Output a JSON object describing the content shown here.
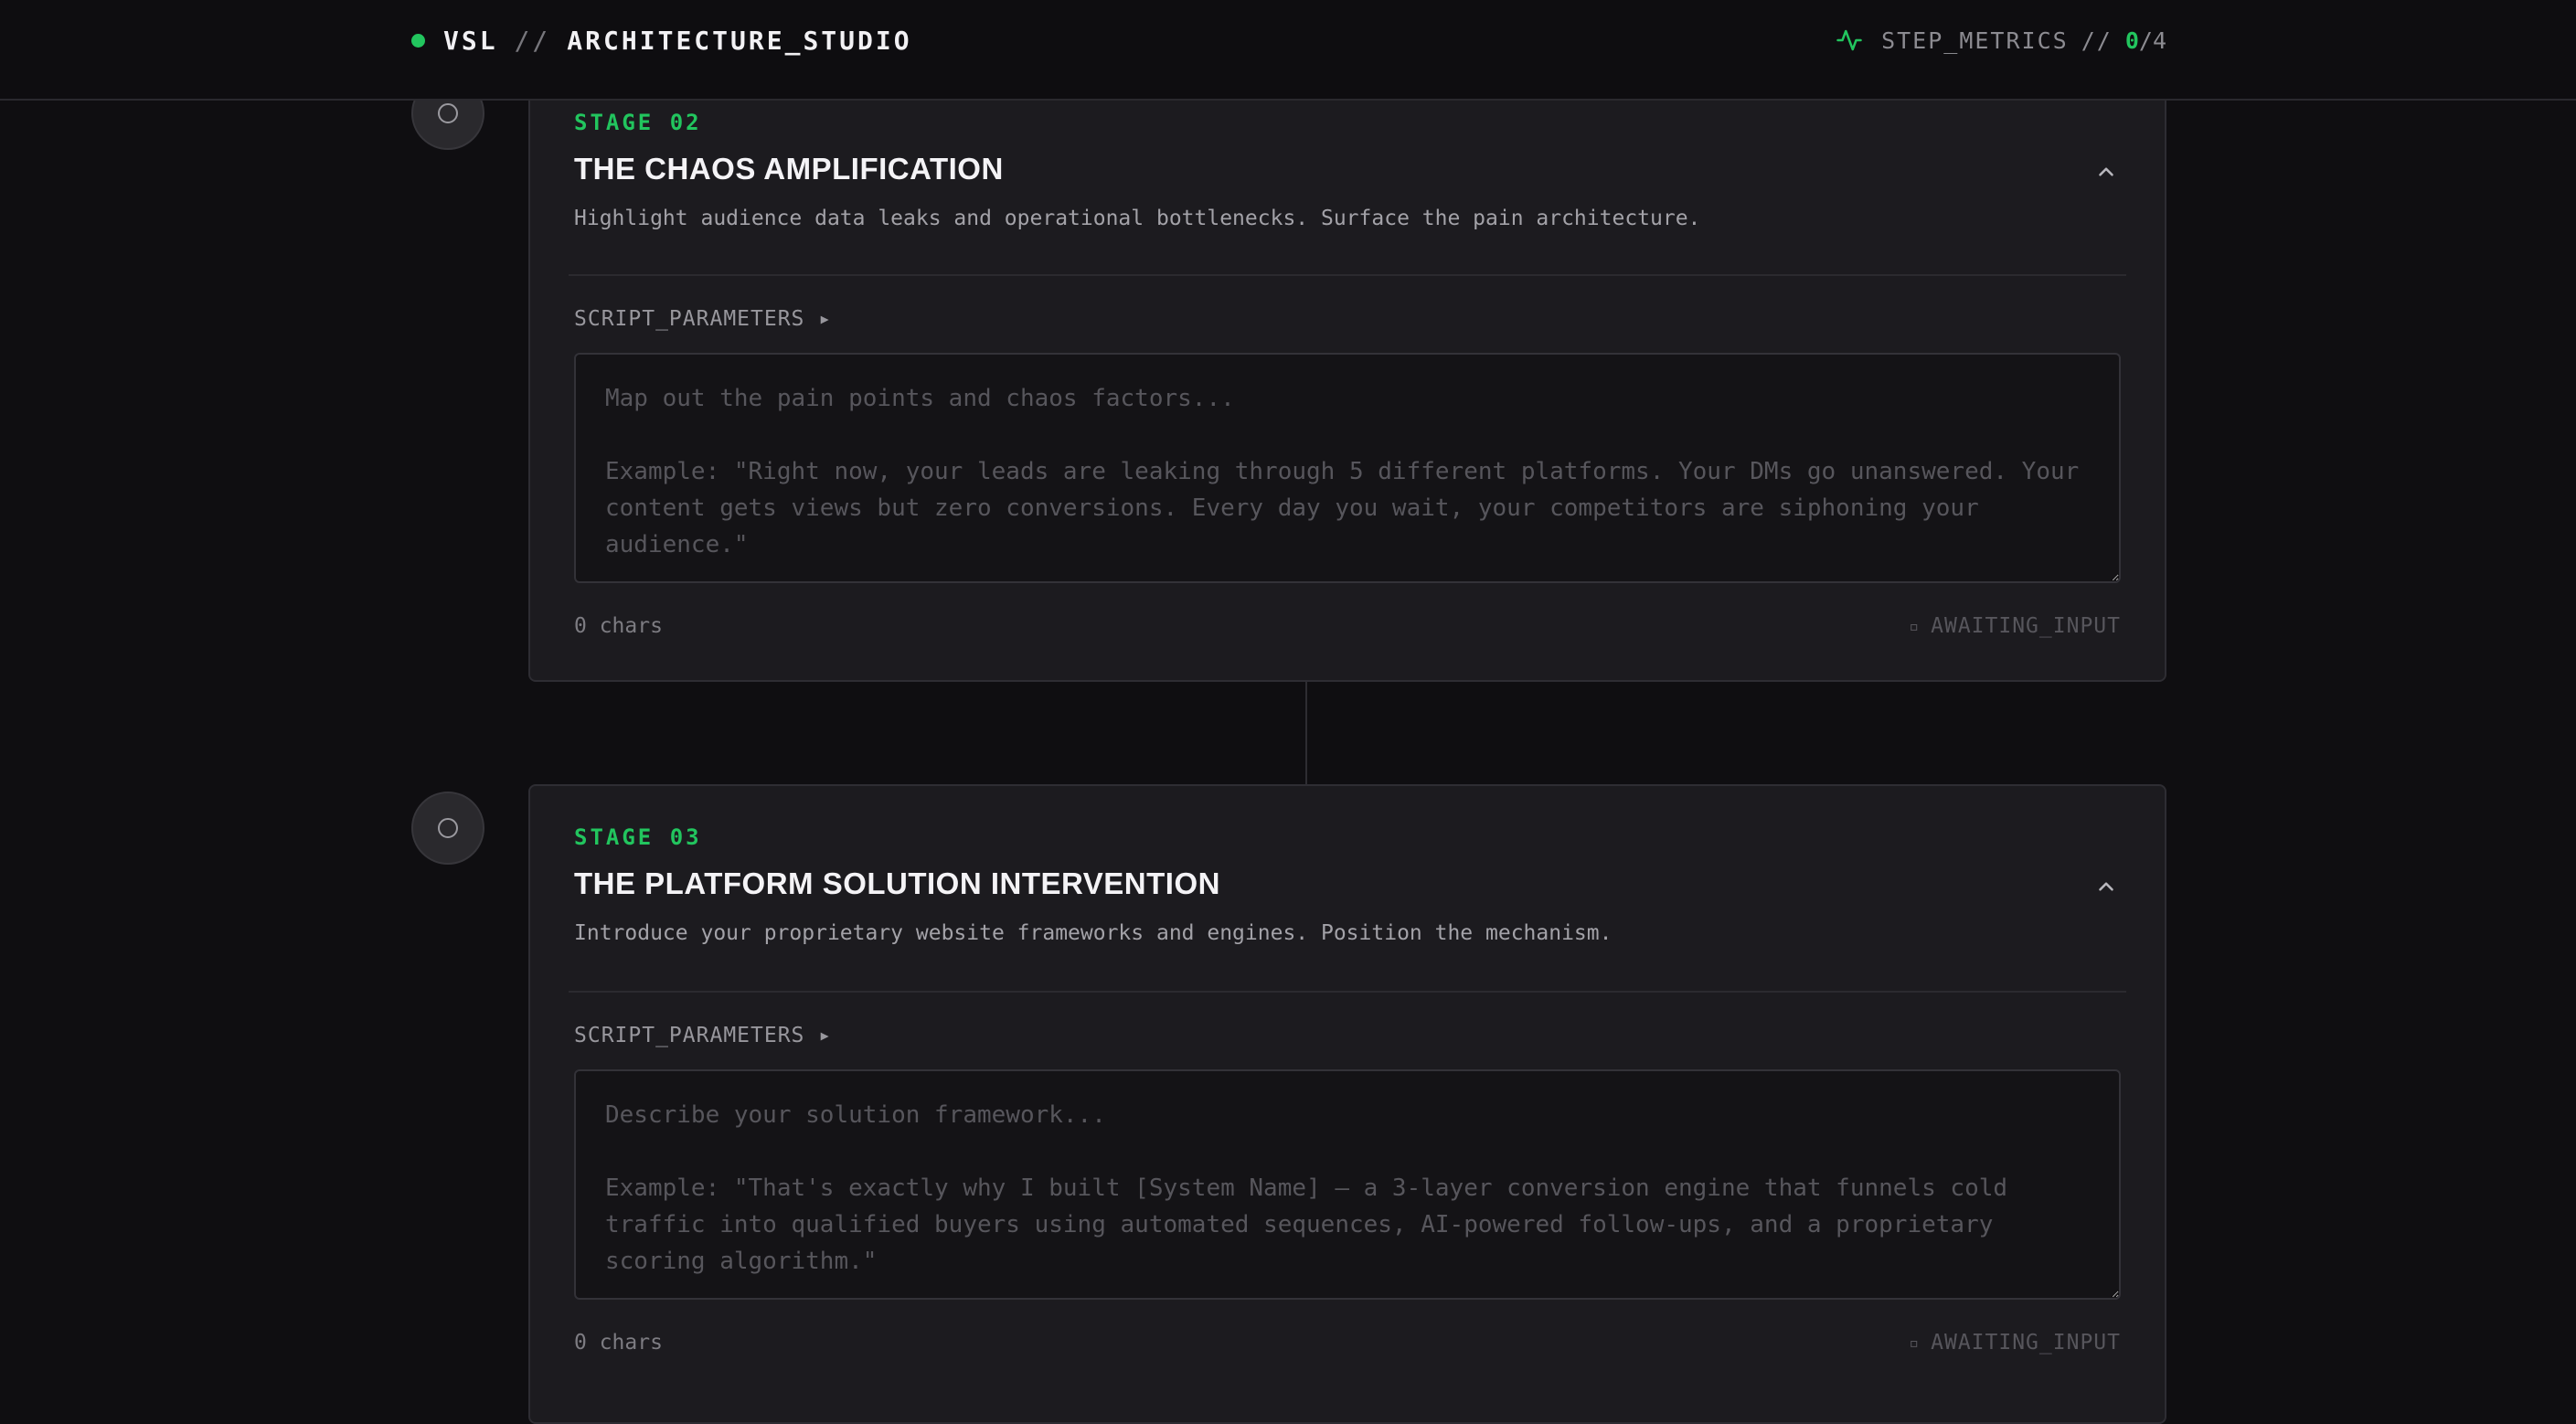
{
  "header": {
    "brand_prefix": "VSL",
    "brand_sep": "//",
    "brand_name": "ARCHITECTURE_STUDIO",
    "metrics_label": "STEP_METRICS",
    "metrics_sep": "//",
    "metrics_done": "0",
    "metrics_slash": "/",
    "metrics_total": "4",
    "accent_color": "#22c55e"
  },
  "stages": [
    {
      "label": "STAGE 02",
      "title": "THE CHAOS AMPLIFICATION",
      "description": "Highlight audience data leaks and operational bottlenecks. Surface the pain architecture.",
      "params_label": "SCRIPT_PARAMETERS ▸",
      "input_value": "",
      "placeholder": "Map out the pain points and chaos factors...\n\nExample: \"Right now, your leads are leaking through 5 different platforms. Your DMs go unanswered. Your content gets views but zero conversions. Every day you wait, your competitors are siphoning your audience.\"",
      "char_count": "0 chars",
      "status_icon": "▫",
      "status": "AWAITING_INPUT"
    },
    {
      "label": "STAGE 03",
      "title": "THE PLATFORM SOLUTION INTERVENTION",
      "description": "Introduce your proprietary website frameworks and engines. Position the mechanism.",
      "params_label": "SCRIPT_PARAMETERS ▸",
      "input_value": "",
      "placeholder": "Describe your solution framework...\n\nExample: \"That's exactly why I built [System Name] — a 3-layer conversion engine that funnels cold traffic into qualified buyers using automated sequences, AI-powered follow-ups, and a proprietary scoring algorithm.\"",
      "char_count": "0 chars",
      "status_icon": "▫",
      "status": "AWAITING_INPUT"
    }
  ]
}
